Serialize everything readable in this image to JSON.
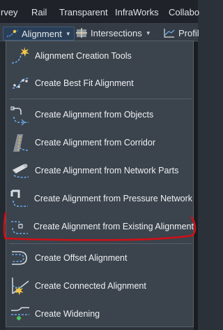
{
  "ribbon_tabs": [
    "rvey",
    "Rail",
    "Transparent",
    "InfraWorks",
    "Collabo"
  ],
  "panel": {
    "alignment_label": "Alignment",
    "intersections_label": "Intersections",
    "profile_label": "Profil"
  },
  "menu": {
    "items": [
      {
        "label": "Alignment Creation Tools",
        "icon": "alignment-tools-icon"
      },
      {
        "label": "Create Best Fit Alignment",
        "icon": "best-fit-alignment-icon"
      },
      {
        "label": "Create Alignment from Objects",
        "icon": "alignment-from-objects-icon"
      },
      {
        "label": "Create Alignment from Corridor",
        "icon": "alignment-from-corridor-icon"
      },
      {
        "label": "Create Alignment from Network Parts",
        "icon": "alignment-from-network-parts-icon"
      },
      {
        "label": "Create Alignment from Pressure Network",
        "icon": "alignment-from-pressure-network-icon"
      },
      {
        "label": "Create Alignment from Existing Alignment",
        "icon": "alignment-from-existing-icon"
      },
      {
        "label": "Create Offset Alignment",
        "icon": "offset-alignment-icon"
      },
      {
        "label": "Create Connected Alignment",
        "icon": "connected-alignment-icon"
      },
      {
        "label": "Create Widening",
        "icon": "widening-icon"
      }
    ]
  },
  "colors": {
    "menu_bg": "#3b434c",
    "highlight_annotation": "#d10f16",
    "accent_blue": "#6aa9e9"
  }
}
